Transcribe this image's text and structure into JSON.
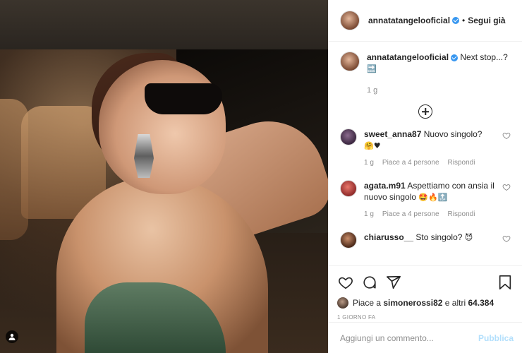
{
  "header": {
    "username": "annatatangelooficial",
    "separator": "•",
    "follow_label": "Segui già"
  },
  "caption": {
    "username": "annatatangelooficial",
    "text": "Next stop...?",
    "emoji": "🔜",
    "time": "1 g"
  },
  "comments": [
    {
      "username": "sweet_anna87",
      "text": "Nuovo singolo?",
      "emoji": "🤗♥",
      "time": "1 g",
      "likes": "Piace a 4 persone",
      "reply": "Rispondi"
    },
    {
      "username": "agata.m91",
      "text": "Aspettiamo con ansia il nuovo singolo",
      "emoji": "🤩🔥🔝",
      "time": "1 g",
      "likes": "Piace a 4 persone",
      "reply": "Rispondi"
    },
    {
      "username": "chiarusso__",
      "text": "Sto singolo?",
      "emoji": "😈",
      "time": "",
      "likes": "",
      "reply": ""
    }
  ],
  "actions": {
    "liked_by_prefix": "Piace a",
    "liked_by_user": "simonerossi82",
    "liked_by_suffix": "e altri",
    "likes_count": "64.384",
    "date": "1 GIORNO FA"
  },
  "add_comment": {
    "placeholder": "Aggiungi un commento...",
    "publish_label": "Pubblica"
  },
  "colors": {
    "verified": "#3897f0",
    "publish_disabled": "#b2dffc",
    "muted_text": "#8e8e8e"
  },
  "icons": [
    "user-tag-icon",
    "verified-icon",
    "plus-circle-icon",
    "heart-icon",
    "comment-icon",
    "share-icon",
    "bookmark-icon"
  ]
}
